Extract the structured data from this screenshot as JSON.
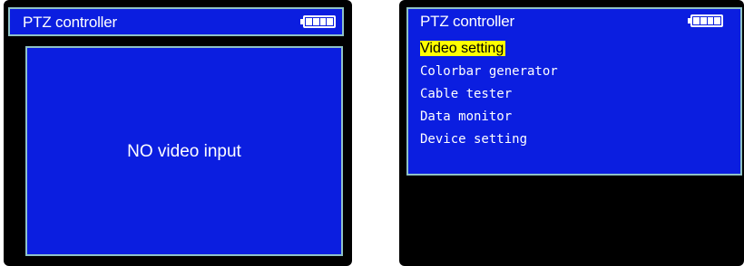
{
  "left_screen": {
    "title": "PTZ controller",
    "battery_level": 1.0,
    "message": "NO video input"
  },
  "right_screen": {
    "title": "PTZ controller",
    "battery_level": 1.0,
    "menu": [
      {
        "label": "Video setting",
        "selected": true
      },
      {
        "label": "Colorbar generator",
        "selected": false
      },
      {
        "label": "Cable tester",
        "selected": false
      },
      {
        "label": "Data monitor",
        "selected": false
      },
      {
        "label": "Device setting",
        "selected": false
      }
    ]
  },
  "colors": {
    "screen_blue": "#0b1ee0",
    "frame_border": "#8fc2c6",
    "highlight": "#ffff00",
    "bezel": "#000000"
  }
}
